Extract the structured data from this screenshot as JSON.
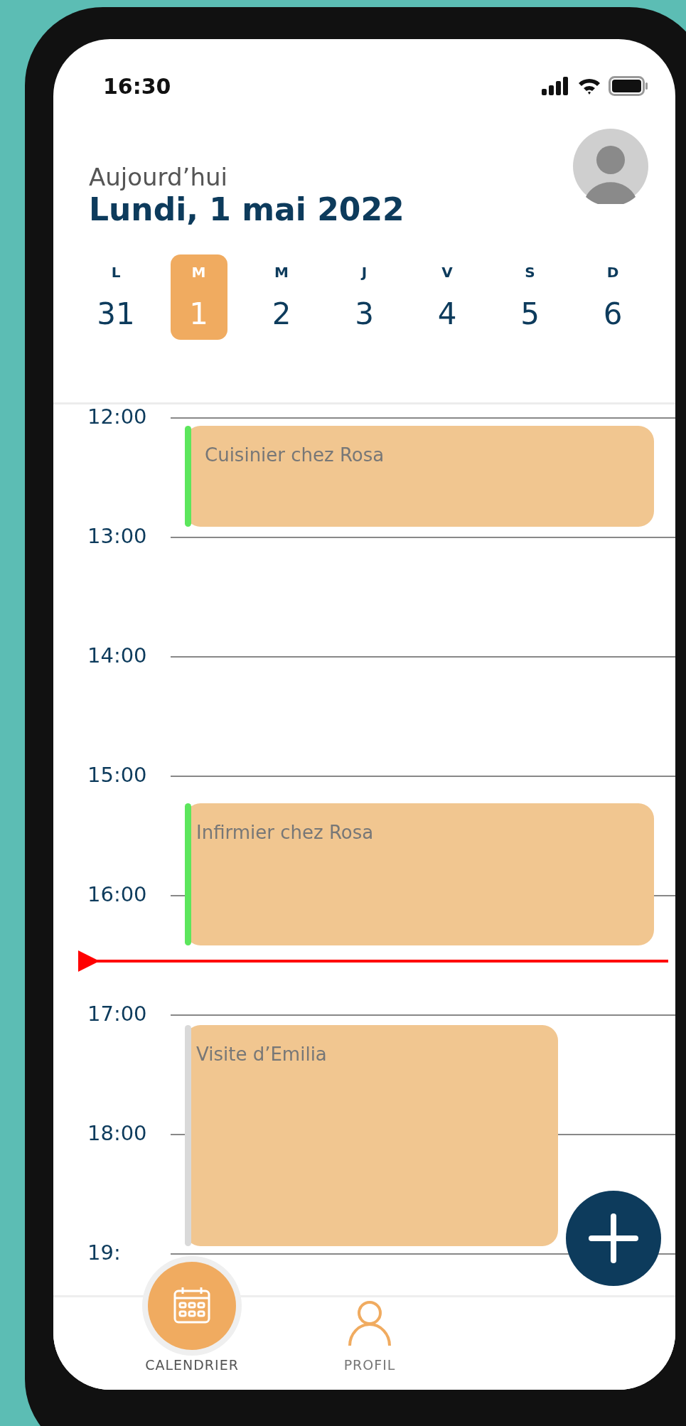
{
  "status_bar": {
    "time": "16:30"
  },
  "header": {
    "subtitle": "Aujourd’hui",
    "title": "Lundi, 1 mai 2022"
  },
  "week": [
    {
      "letter": "L",
      "day": "31",
      "selected": false
    },
    {
      "letter": "M",
      "day": "1",
      "selected": true
    },
    {
      "letter": "M",
      "day": "2",
      "selected": false
    },
    {
      "letter": "J",
      "day": "3",
      "selected": false
    },
    {
      "letter": "V",
      "day": "4",
      "selected": false
    },
    {
      "letter": "S",
      "day": "5",
      "selected": false
    },
    {
      "letter": "D",
      "day": "6",
      "selected": false
    }
  ],
  "hours": [
    {
      "label": "12:00",
      "events": [
        {
          "title": "Cuisinier chez Rosa",
          "color": "#5ce65c"
        }
      ]
    },
    {
      "label": "13:00"
    },
    {
      "label": "14:00"
    },
    {
      "label": "15:00",
      "events": [
        {
          "title": "Infirmier chez Rosa",
          "color": "#5ce65c"
        }
      ]
    },
    {
      "label": "16:00",
      "now": true
    },
    {
      "label": "17:00",
      "events": [
        {
          "title": "Visite d’Emilia",
          "color": "#d9d9d9"
        }
      ]
    },
    {
      "label": "18:00"
    },
    {
      "label": "19:"
    }
  ],
  "nav": [
    {
      "label": "CALENDRIER",
      "kind": "calendar",
      "selected": true
    },
    {
      "label": "PROFIL",
      "kind": "profile",
      "selected": false
    }
  ]
}
